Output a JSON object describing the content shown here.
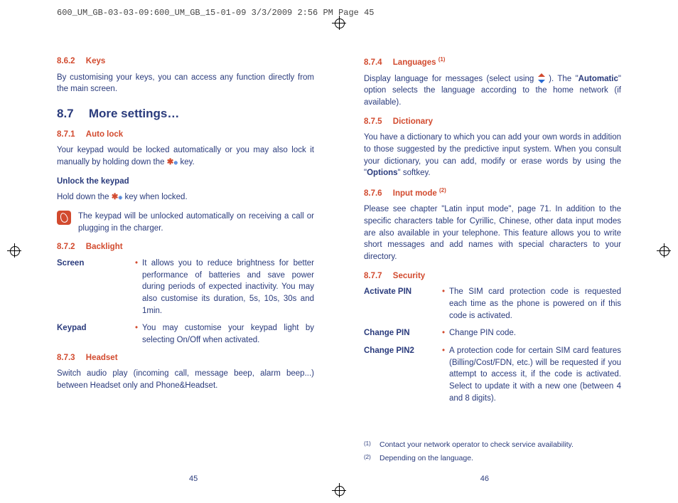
{
  "slug": "600_UM_GB-03-03-09:600_UM_GB_15-01-09  3/3/2009  2:56 PM  Page 45",
  "left": {
    "s862_num": "8.6.2",
    "s862_title": "Keys",
    "s862_body": "By customising your keys, you can access any function directly from the main screen.",
    "s87_num": "8.7",
    "s87_title": "More settings…",
    "s871_num": "8.7.1",
    "s871_title": "Auto lock",
    "s871_body_a": "Your keypad would be locked automatically or you may also lock it manually by holding down the ",
    "s871_body_b": " key.",
    "unlock_h": "Unlock the keypad",
    "unlock_body_a": "Hold down the ",
    "unlock_body_b": " key when locked.",
    "note": "The keypad will be unlocked automatically on receiving a call or plugging in the charger.",
    "s872_num": "8.7.2",
    "s872_title": "Backlight",
    "screen_label": "Screen",
    "screen_body": "It allows you to reduce brightness for better performance of batteries and save power during periods of expected inactivity. You may also customise its duration, 5s, 10s, 30s and 1min.",
    "keypad_label": "Keypad",
    "keypad_body": "You may customise your keypad light by selecting On/Off when activated.",
    "s873_num": "8.7.3",
    "s873_title": "Headset",
    "s873_body": "Switch audio play (incoming call, message beep, alarm beep...) between Headset only and Phone&Headset.",
    "page": "45"
  },
  "right": {
    "s874_num": "8.7.4",
    "s874_title": "Languages ",
    "s874_sup": "(1)",
    "s874_body_a": "Display language for messages (select using ",
    "s874_body_b": "). The \"",
    "s874_bold": "Automatic",
    "s874_body_c": "\" option selects the language according to the home network (if available).",
    "s875_num": "8.7.5",
    "s875_title": "Dictionary",
    "s875_body_a": "You have a dictionary to which you can add your own words in addition to those suggested by the predictive input system. When you consult your dictionary, you can add, modify or erase words by using the \"",
    "s875_bold": "Options",
    "s875_body_b": "\" softkey.",
    "s876_num": "8.7.6",
    "s876_title": "Input mode ",
    "s876_sup": "(2)",
    "s876_body": "Please see chapter \"Latin input mode\", page 71. In addition to the specific characters table for Cyrillic, Chinese, other data input modes are also available in your telephone. This feature allows you to write short messages and add names with special characters to your directory.",
    "s877_num": "8.7.7",
    "s877_title": "Security",
    "activate_label": "Activate PIN",
    "activate_body": "The SIM card protection code is requested each time as the phone is powered on if this code is activated.",
    "change_label": "Change PIN",
    "change_body": "Change PIN code.",
    "change2_label": "Change PIN2",
    "change2_body": "A protection code for certain SIM card features (Billing/Cost/FDN, etc.) will be requested if you attempt to access it, if the code is activated. Select to update it with a new one (between 4 and 8 digits).",
    "fn1_mark": "(1)",
    "fn1": "Contact your network operator to check service availability.",
    "fn2_mark": "(2)",
    "fn2": "Depending on the language.",
    "page": "46"
  }
}
